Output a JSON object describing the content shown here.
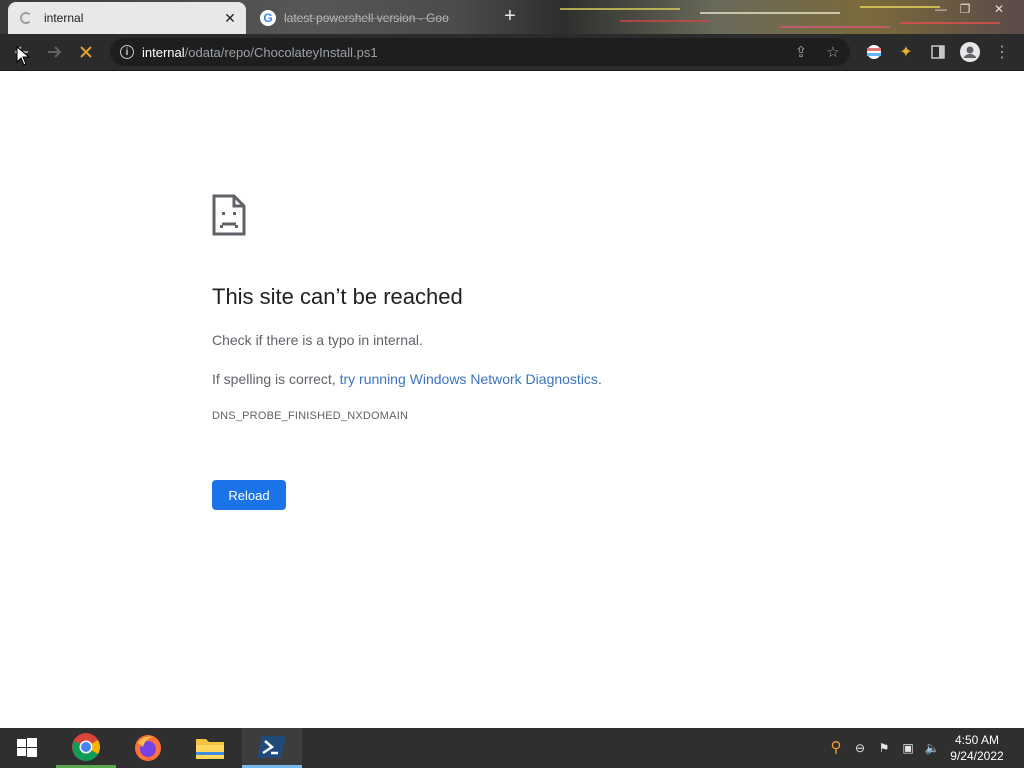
{
  "browser": {
    "tabs": [
      {
        "title": "internal",
        "active": true
      },
      {
        "title": "latest powershell version - Goo",
        "active": false
      }
    ],
    "address": {
      "host": "internal",
      "path": "/odata/repo/ChocolateyInstall.ps1"
    }
  },
  "error": {
    "title": "This site can’t be reached",
    "line1": "Check if there is a typo in internal.",
    "line2_prefix": "If spelling is correct, ",
    "line2_link": "try running Windows Network Diagnostics",
    "line2_suffix": ".",
    "code": "DNS_PROBE_FINISHED_NXDOMAIN",
    "reload_label": "Reload"
  },
  "taskbar": {
    "apps": [
      "windows-start",
      "chrome",
      "firefox",
      "file-explorer",
      "powershell"
    ],
    "clock": {
      "time": "4:50 AM",
      "date": "9/24/2022"
    }
  },
  "colors": {
    "accent": "#1a73e8",
    "link": "#3c73c0",
    "taskbar": "#2f2f2f"
  }
}
